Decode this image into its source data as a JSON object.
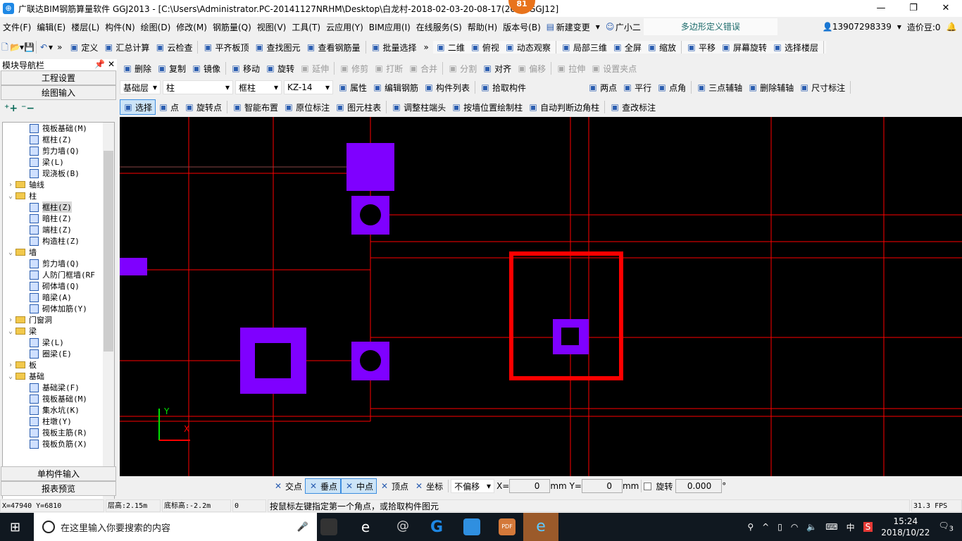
{
  "title": "广联达BIM钢筋算量软件 GGJ2013 - [C:\\Users\\Administrator.PC-20141127NRHM\\Desktop\\白龙村-2018-02-03-20-08-17(260...GGJ12]",
  "notification_badge": "81",
  "menu": [
    "文件(F)",
    "编辑(E)",
    "楼层(L)",
    "构件(N)",
    "绘图(D)",
    "修改(M)",
    "钢筋量(Q)",
    "视图(V)",
    "工具(T)",
    "云应用(Y)",
    "BIM应用(I)",
    "在线服务(S)",
    "帮助(H)",
    "版本号(B)"
  ],
  "menu_extra": {
    "new_change": "新建变更",
    "assistant": "广小二",
    "error_msg": "多边形定义错误",
    "phone": "13907298339",
    "beans": "造价豆:0"
  },
  "toolbar1": [
    "定义",
    "汇总计算",
    "云检查",
    "平齐板顶",
    "查找图元",
    "查看钢筋量",
    "批量选择"
  ],
  "toolbar1_view": [
    "二维",
    "俯视",
    "动态观察",
    "局部三维",
    "全屏",
    "缩放",
    "平移",
    "屏幕旋转",
    "选择楼层"
  ],
  "toolbar2": [
    {
      "label": "删除",
      "enabled": true
    },
    {
      "label": "复制",
      "enabled": true
    },
    {
      "label": "镜像",
      "enabled": true
    },
    {
      "label": "移动",
      "enabled": true
    },
    {
      "label": "旋转",
      "enabled": true
    },
    {
      "label": "延伸",
      "enabled": false
    },
    {
      "label": "修剪",
      "enabled": false
    },
    {
      "label": "打断",
      "enabled": false
    },
    {
      "label": "合并",
      "enabled": false
    },
    {
      "label": "分割",
      "enabled": false
    },
    {
      "label": "对齐",
      "enabled": true
    },
    {
      "label": "偏移",
      "enabled": false
    },
    {
      "label": "拉伸",
      "enabled": false
    },
    {
      "label": "设置夹点",
      "enabled": false
    }
  ],
  "selectors": {
    "floor": "基础层",
    "type": "柱",
    "subtype": "框柱",
    "component": "KZ-14"
  },
  "toolbar3": [
    "属性",
    "编辑钢筋",
    "构件列表",
    "拾取构件"
  ],
  "toolbar3_axis": [
    "两点",
    "平行",
    "点角",
    "三点辅轴",
    "删除辅轴",
    "尺寸标注"
  ],
  "toolbar4": [
    "选择",
    "点",
    "旋转点",
    "智能布置",
    "原位标注",
    "图元柱表",
    "调整柱端头",
    "按墙位置绘制柱",
    "自动判断边角柱",
    "查改标注"
  ],
  "sidebar": {
    "title": "模块导航栏",
    "btn_project": "工程设置",
    "btn_draw": "绘图输入",
    "btn_single": "单构件输入",
    "btn_report": "报表预览",
    "tree": [
      {
        "label": "筏板基础(M)",
        "level": 2
      },
      {
        "label": "框柱(Z)",
        "level": 2
      },
      {
        "label": "剪力墙(Q)",
        "level": 2
      },
      {
        "label": "梁(L)",
        "level": 2
      },
      {
        "label": "现浇板(B)",
        "level": 2
      },
      {
        "label": "轴线",
        "level": 1,
        "expanded": false
      },
      {
        "label": "柱",
        "level": 1,
        "expanded": true
      },
      {
        "label": "框柱(Z)",
        "level": 2,
        "selected": true
      },
      {
        "label": "暗柱(Z)",
        "level": 2
      },
      {
        "label": "端柱(Z)",
        "level": 2
      },
      {
        "label": "构造柱(Z)",
        "level": 2
      },
      {
        "label": "墙",
        "level": 1,
        "expanded": true
      },
      {
        "label": "剪力墙(Q)",
        "level": 2
      },
      {
        "label": "人防门框墙(RF",
        "level": 2
      },
      {
        "label": "砌体墙(Q)",
        "level": 2
      },
      {
        "label": "暗梁(A)",
        "level": 2
      },
      {
        "label": "砌体加筋(Y)",
        "level": 2
      },
      {
        "label": "门窗洞",
        "level": 1,
        "expanded": false
      },
      {
        "label": "梁",
        "level": 1,
        "expanded": true
      },
      {
        "label": "梁(L)",
        "level": 2
      },
      {
        "label": "圈梁(E)",
        "level": 2
      },
      {
        "label": "板",
        "level": 1,
        "expanded": false
      },
      {
        "label": "基础",
        "level": 1,
        "expanded": true
      },
      {
        "label": "基础梁(F)",
        "level": 2
      },
      {
        "label": "筏板基础(M)",
        "level": 2
      },
      {
        "label": "集水坑(K)",
        "level": 2
      },
      {
        "label": "柱墩(Y)",
        "level": 2
      },
      {
        "label": "筏板主筋(R)",
        "level": 2
      },
      {
        "label": "筏板负筋(X)",
        "level": 2
      }
    ]
  },
  "canvas": {
    "axis_x": "X",
    "axis_y": "Y",
    "colors": {
      "background": "#000000",
      "axis_lines": "#ff0000",
      "columns": "#7f00ff"
    }
  },
  "snap": {
    "items": [
      {
        "label": "交点",
        "on": false
      },
      {
        "label": "垂点",
        "on": true
      },
      {
        "label": "中点",
        "on": true
      },
      {
        "label": "顶点",
        "on": false
      },
      {
        "label": "坐标",
        "on": false
      }
    ],
    "offset_mode": "不偏移",
    "x_label": "X=",
    "x": "0",
    "y_label": "Y=",
    "y": "0",
    "unit": "mm",
    "rotate_label": "旋转",
    "rotate": "0.000",
    "deg": "°",
    "rotate_checked": false
  },
  "status": {
    "coords": "X=47940 Y=6810",
    "floor_height": "层高:2.15m",
    "bottom_elev": "底标高:-2.2m",
    "zero": "0",
    "hint": "按鼠标左键指定第一个角点，或拾取构件图元",
    "fps": "31.3 FPS"
  },
  "taskbar": {
    "search_placeholder": "在这里输入你要搜索的内容",
    "time": "15:24",
    "date": "2018/10/22",
    "ime": "中",
    "notifications": "3"
  }
}
